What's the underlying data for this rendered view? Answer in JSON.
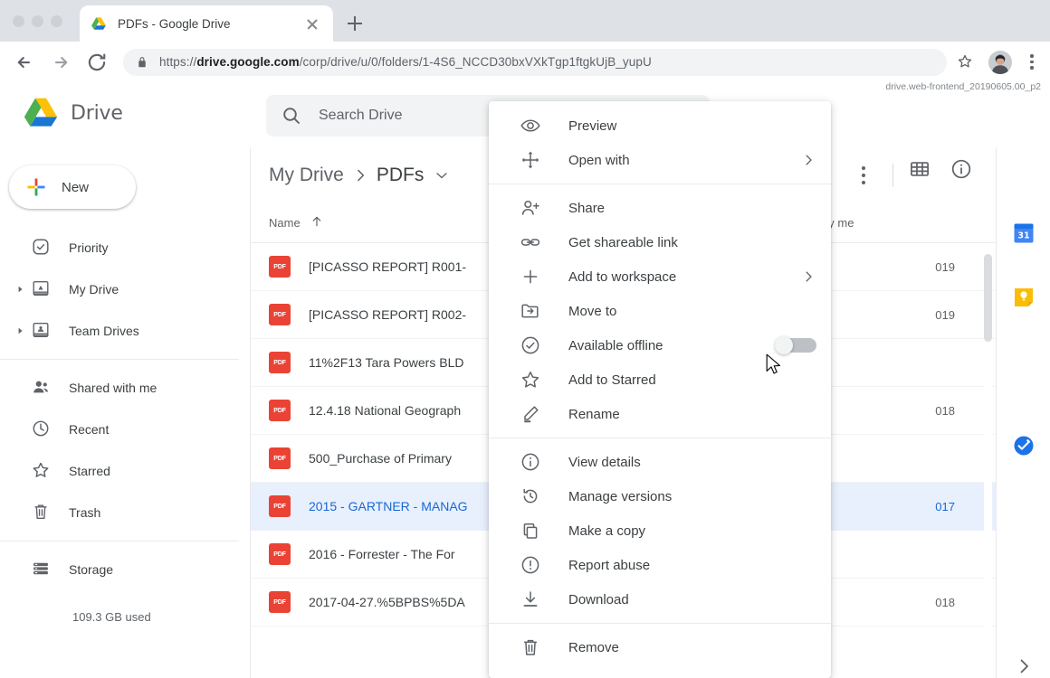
{
  "browser": {
    "tab": {
      "title": "PDFs - Google Drive",
      "favicon": "drive-favicon"
    },
    "new_tab_label": "+",
    "url_prefix": "https://",
    "url_domain": "drive.google.com",
    "url_path": "/corp/drive/u/0/folders/1-4S6_NCCD30bxVXkTgp1ftgkUjB_yupU",
    "back_icon": "back-arrow-icon",
    "forward_icon": "forward-arrow-icon",
    "reload_icon": "reload-icon",
    "lock_icon": "lock-icon",
    "bookmark_icon": "star-icon",
    "profile_icon": "profile-avatar-icon",
    "menu_icon": "chrome-menu-icon"
  },
  "header": {
    "brand": "Drive",
    "brand_logo": "drive-logo",
    "search": {
      "placeholder": "Search Drive",
      "value": "",
      "icon": "search-icon"
    },
    "version": "drive.web-frontend_20190605.00_p2",
    "settings_icon": "gear-icon",
    "apps_icon": "apps-grid-icon",
    "blocks_icon": "google-blocks-icon",
    "avatar_icon": "user-avatar"
  },
  "sidebar": {
    "new_button": {
      "label": "New",
      "icon": "plus-icon"
    },
    "items": [
      {
        "label": "Priority",
        "icon": "priority-check-icon",
        "caret": false
      },
      {
        "label": "My Drive",
        "icon": "my-drive-icon",
        "caret": true
      },
      {
        "label": "Team Drives",
        "icon": "team-drives-icon",
        "caret": true
      },
      {
        "label": "Shared with me",
        "icon": "people-icon",
        "caret": false
      },
      {
        "label": "Recent",
        "icon": "clock-icon",
        "caret": false
      },
      {
        "label": "Starred",
        "icon": "star-outline-icon",
        "caret": false
      },
      {
        "label": "Trash",
        "icon": "trash-icon",
        "caret": false
      },
      {
        "label": "Storage",
        "icon": "storage-icon",
        "caret": false
      }
    ],
    "storage_used": "109.3 GB used"
  },
  "main": {
    "breadcrumb": {
      "root": "My Drive",
      "current": "PDFs",
      "separator_icon": "chevron-right-icon",
      "caret_icon": "caret-down-icon"
    },
    "toolbar": {
      "more_icon": "more-vertical-icon",
      "grid_view_icon": "grid-view-icon",
      "details_icon": "info-circle-icon"
    },
    "columns": {
      "name": "Name",
      "sort_icon": "arrow-up-icon",
      "owner": "ed by me"
    },
    "rows": [
      {
        "name": "[PICASSO REPORT] R001-",
        "year": "019",
        "icon": "pdf-icon",
        "selected": false
      },
      {
        "name": "[PICASSO REPORT] R002-",
        "year": "019",
        "icon": "pdf-icon",
        "selected": false
      },
      {
        "name": "11%2F13 Tara Powers BLD",
        "year": "",
        "icon": "pdf-icon",
        "selected": false
      },
      {
        "name": "12.4.18 National Geograph",
        "year": "018",
        "icon": "pdf-icon",
        "selected": false
      },
      {
        "name": "500_Purchase of Primary ",
        "year": "",
        "icon": "pdf-icon",
        "selected": false
      },
      {
        "name": "2015 - GARTNER - MANAG",
        "year": "017",
        "icon": "pdf-icon",
        "selected": true
      },
      {
        "name": "2016 - Forrester - The For",
        "year": "",
        "icon": "pdf-icon",
        "selected": false
      },
      {
        "name": "2017-04-27.%5BPBS%5DA",
        "year": "018",
        "icon": "pdf-icon",
        "selected": false
      }
    ]
  },
  "context_menu": {
    "groups": [
      [
        {
          "label": "Preview",
          "icon": "eye-icon",
          "submenu": false,
          "toggle": false
        },
        {
          "label": "Open with",
          "icon": "open-with-icon",
          "submenu": true,
          "toggle": false
        }
      ],
      [
        {
          "label": "Share",
          "icon": "person-add-icon",
          "submenu": false,
          "toggle": false
        },
        {
          "label": "Get shareable link",
          "icon": "link-icon",
          "submenu": false,
          "toggle": false
        },
        {
          "label": "Add to workspace",
          "icon": "plus-thin-icon",
          "submenu": true,
          "toggle": false
        },
        {
          "label": "Move to",
          "icon": "move-to-folder-icon",
          "submenu": false,
          "toggle": false
        },
        {
          "label": "Available offline",
          "icon": "offline-check-icon",
          "submenu": false,
          "toggle": true,
          "toggle_on": false
        },
        {
          "label": "Add to Starred",
          "icon": "star-outline-icon",
          "submenu": false,
          "toggle": false
        },
        {
          "label": "Rename",
          "icon": "pencil-icon",
          "submenu": false,
          "toggle": false
        }
      ],
      [
        {
          "label": "View details",
          "icon": "info-circle-icon",
          "submenu": false,
          "toggle": false
        },
        {
          "label": "Manage versions",
          "icon": "history-icon",
          "submenu": false,
          "toggle": false
        },
        {
          "label": "Make a copy",
          "icon": "copy-icon",
          "submenu": false,
          "toggle": false
        },
        {
          "label": "Report abuse",
          "icon": "warning-circle-icon",
          "submenu": false,
          "toggle": false
        },
        {
          "label": "Download",
          "icon": "download-icon",
          "submenu": false,
          "toggle": false
        }
      ],
      [
        {
          "label": "Remove",
          "icon": "trash-icon",
          "submenu": false,
          "toggle": false
        }
      ]
    ]
  },
  "rail": {
    "items": [
      {
        "name": "google-calendar-icon",
        "label": "31",
        "color": "#4285f4"
      },
      {
        "name": "google-keep-icon",
        "label": "",
        "color": "#fbbc04"
      },
      {
        "name": "google-tasks-icon",
        "label": "",
        "color": "#1a73e8"
      }
    ],
    "expand_icon": "chevron-right-icon"
  },
  "colors": {
    "accent": "#1a73e8",
    "selection_bg": "#e8f0fe",
    "pdf_red": "#ea4335",
    "text": "#3c4043",
    "muted": "#5f6368"
  }
}
